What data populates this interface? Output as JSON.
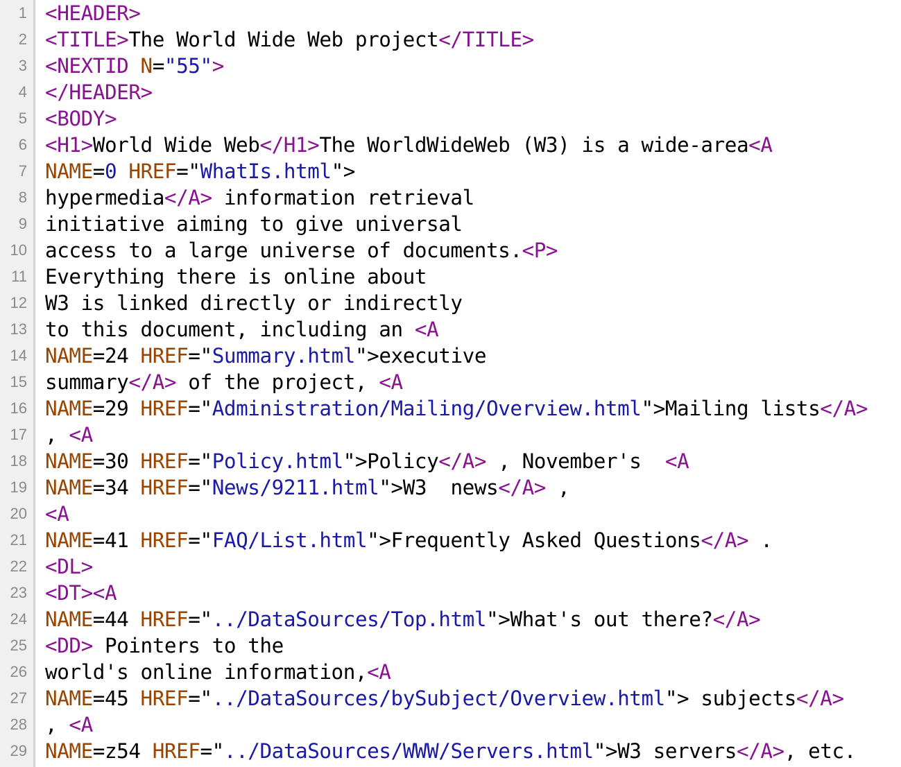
{
  "colors": {
    "tag": "#881391",
    "attribute": "#994500",
    "string": "#1a1aa6",
    "text": "#000000",
    "gutter_bg": "#f0f0f0",
    "gutter_text": "#8a8a8a"
  },
  "lines": [
    {
      "n": "1",
      "tokens": [
        {
          "k": "tag",
          "t": "<HEADER>"
        }
      ]
    },
    {
      "n": "2",
      "tokens": [
        {
          "k": "tag",
          "t": "<TITLE>"
        },
        {
          "k": "text",
          "t": "The World Wide Web project"
        },
        {
          "k": "tag",
          "t": "</TITLE>"
        }
      ]
    },
    {
      "n": "3",
      "tokens": [
        {
          "k": "tag",
          "t": "<NEXTID "
        },
        {
          "k": "attr",
          "t": "N"
        },
        {
          "k": "text",
          "t": "="
        },
        {
          "k": "str",
          "t": "\"55\""
        },
        {
          "k": "tag",
          "t": ">"
        }
      ]
    },
    {
      "n": "4",
      "tokens": [
        {
          "k": "tag",
          "t": "</HEADER>"
        }
      ]
    },
    {
      "n": "5",
      "tokens": [
        {
          "k": "tag",
          "t": "<BODY>"
        }
      ]
    },
    {
      "n": "6",
      "tokens": [
        {
          "k": "tag",
          "t": "<H1>"
        },
        {
          "k": "text",
          "t": "World Wide Web"
        },
        {
          "k": "tag",
          "t": "</H1>"
        },
        {
          "k": "text",
          "t": "The WorldWideWeb (W3) is a wide-area"
        },
        {
          "k": "tag",
          "t": "<A"
        }
      ]
    },
    {
      "n": "7",
      "tokens": [
        {
          "k": "attr",
          "t": "NAME"
        },
        {
          "k": "text",
          "t": "="
        },
        {
          "k": "str",
          "t": "0"
        },
        {
          "k": "text",
          "t": " "
        },
        {
          "k": "attr",
          "t": "HREF"
        },
        {
          "k": "text",
          "t": "=\""
        },
        {
          "k": "str",
          "t": "WhatIs.html"
        },
        {
          "k": "text",
          "t": "\">"
        }
      ]
    },
    {
      "n": "8",
      "tokens": [
        {
          "k": "text",
          "t": "hypermedia"
        },
        {
          "k": "tag",
          "t": "</A>"
        },
        {
          "k": "text",
          "t": " information retrieval"
        }
      ]
    },
    {
      "n": "9",
      "tokens": [
        {
          "k": "text",
          "t": "initiative aiming to give universal"
        }
      ]
    },
    {
      "n": "10",
      "tokens": [
        {
          "k": "text",
          "t": "access to a large universe of documents."
        },
        {
          "k": "tag",
          "t": "<P>"
        }
      ]
    },
    {
      "n": "11",
      "tokens": [
        {
          "k": "text",
          "t": "Everything there is online about"
        }
      ]
    },
    {
      "n": "12",
      "tokens": [
        {
          "k": "text",
          "t": "W3 is linked directly or indirectly"
        }
      ]
    },
    {
      "n": "13",
      "tokens": [
        {
          "k": "text",
          "t": "to this document, including an "
        },
        {
          "k": "tag",
          "t": "<A"
        }
      ]
    },
    {
      "n": "14",
      "tokens": [
        {
          "k": "attr",
          "t": "NAME"
        },
        {
          "k": "text",
          "t": "=24 "
        },
        {
          "k": "attr",
          "t": "HREF"
        },
        {
          "k": "text",
          "t": "=\""
        },
        {
          "k": "str",
          "t": "Summary.html"
        },
        {
          "k": "text",
          "t": "\">executive"
        }
      ]
    },
    {
      "n": "15",
      "tokens": [
        {
          "k": "text",
          "t": "summary"
        },
        {
          "k": "tag",
          "t": "</A>"
        },
        {
          "k": "text",
          "t": " of the project, "
        },
        {
          "k": "tag",
          "t": "<A"
        }
      ]
    },
    {
      "n": "16",
      "tokens": [
        {
          "k": "attr",
          "t": "NAME"
        },
        {
          "k": "text",
          "t": "=29 "
        },
        {
          "k": "attr",
          "t": "HREF"
        },
        {
          "k": "text",
          "t": "=\""
        },
        {
          "k": "str",
          "t": "Administration/Mailing/Overview.html"
        },
        {
          "k": "text",
          "t": "\">Mailing lists"
        },
        {
          "k": "tag",
          "t": "</A>"
        }
      ]
    },
    {
      "n": "17",
      "tokens": [
        {
          "k": "text",
          "t": ", "
        },
        {
          "k": "tag",
          "t": "<A"
        }
      ]
    },
    {
      "n": "18",
      "tokens": [
        {
          "k": "attr",
          "t": "NAME"
        },
        {
          "k": "text",
          "t": "=30 "
        },
        {
          "k": "attr",
          "t": "HREF"
        },
        {
          "k": "text",
          "t": "=\""
        },
        {
          "k": "str",
          "t": "Policy.html"
        },
        {
          "k": "text",
          "t": "\">Policy"
        },
        {
          "k": "tag",
          "t": "</A>"
        },
        {
          "k": "text",
          "t": " , November's  "
        },
        {
          "k": "tag",
          "t": "<A"
        }
      ]
    },
    {
      "n": "19",
      "tokens": [
        {
          "k": "attr",
          "t": "NAME"
        },
        {
          "k": "text",
          "t": "=34 "
        },
        {
          "k": "attr",
          "t": "HREF"
        },
        {
          "k": "text",
          "t": "=\""
        },
        {
          "k": "str",
          "t": "News/9211.html"
        },
        {
          "k": "text",
          "t": "\">W3  news"
        },
        {
          "k": "tag",
          "t": "</A>"
        },
        {
          "k": "text",
          "t": " ,"
        }
      ]
    },
    {
      "n": "20",
      "tokens": [
        {
          "k": "tag",
          "t": "<A"
        }
      ]
    },
    {
      "n": "21",
      "tokens": [
        {
          "k": "attr",
          "t": "NAME"
        },
        {
          "k": "text",
          "t": "=41 "
        },
        {
          "k": "attr",
          "t": "HREF"
        },
        {
          "k": "text",
          "t": "=\""
        },
        {
          "k": "str",
          "t": "FAQ/List.html"
        },
        {
          "k": "text",
          "t": "\">Frequently Asked Questions"
        },
        {
          "k": "tag",
          "t": "</A>"
        },
        {
          "k": "text",
          "t": " ."
        }
      ]
    },
    {
      "n": "22",
      "tokens": [
        {
          "k": "tag",
          "t": "<DL>"
        }
      ]
    },
    {
      "n": "23",
      "tokens": [
        {
          "k": "tag",
          "t": "<DT><A"
        }
      ]
    },
    {
      "n": "24",
      "tokens": [
        {
          "k": "attr",
          "t": "NAME"
        },
        {
          "k": "text",
          "t": "=44 "
        },
        {
          "k": "attr",
          "t": "HREF"
        },
        {
          "k": "text",
          "t": "=\""
        },
        {
          "k": "str",
          "t": "../DataSources/Top.html"
        },
        {
          "k": "text",
          "t": "\">What's out there?"
        },
        {
          "k": "tag",
          "t": "</A>"
        }
      ]
    },
    {
      "n": "25",
      "tokens": [
        {
          "k": "tag",
          "t": "<DD>"
        },
        {
          "k": "text",
          "t": " Pointers to the"
        }
      ]
    },
    {
      "n": "26",
      "tokens": [
        {
          "k": "text",
          "t": "world's online information,"
        },
        {
          "k": "tag",
          "t": "<A"
        }
      ]
    },
    {
      "n": "27",
      "tokens": [
        {
          "k": "attr",
          "t": "NAME"
        },
        {
          "k": "text",
          "t": "=45 "
        },
        {
          "k": "attr",
          "t": "HREF"
        },
        {
          "k": "text",
          "t": "=\""
        },
        {
          "k": "str",
          "t": "../DataSources/bySubject/Overview.html"
        },
        {
          "k": "text",
          "t": "\"> subjects"
        },
        {
          "k": "tag",
          "t": "</A>"
        }
      ]
    },
    {
      "n": "28",
      "tokens": [
        {
          "k": "text",
          "t": ", "
        },
        {
          "k": "tag",
          "t": "<A"
        }
      ]
    },
    {
      "n": "29",
      "tokens": [
        {
          "k": "attr",
          "t": "NAME"
        },
        {
          "k": "text",
          "t": "=z54 "
        },
        {
          "k": "attr",
          "t": "HREF"
        },
        {
          "k": "text",
          "t": "=\""
        },
        {
          "k": "str",
          "t": "../DataSources/WWW/Servers.html"
        },
        {
          "k": "text",
          "t": "\">W3 servers"
        },
        {
          "k": "tag",
          "t": "</A>"
        },
        {
          "k": "text",
          "t": ", etc."
        }
      ]
    }
  ]
}
